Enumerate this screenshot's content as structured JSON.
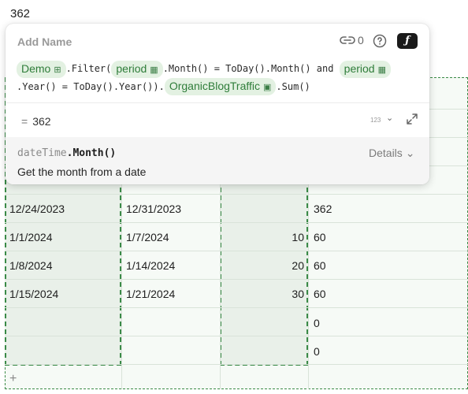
{
  "cell_value": "362",
  "popover": {
    "name_placeholder": "Add Name",
    "links_count": "0",
    "fx_label": "ƒ",
    "formula": {
      "chip_demo": "Demo",
      "t_filter": ".Filter(",
      "chip_period1": "period",
      "t_month_eq": ".Month() = ToDay().Month() and ",
      "chip_period2": "period",
      "t_year_eq": ".Year() = ToDay().Year()).",
      "chip_traffic": "OrganicBlogTraffic",
      "t_sum": ".Sum()"
    },
    "result_eq": "=",
    "result_value": "362",
    "result_type": "123",
    "doc_signature_prefix": "dateTime",
    "doc_signature_fn": ".Month()",
    "doc_details": "Details",
    "doc_description": "Get the month from a date"
  },
  "table": {
    "rows": [
      {
        "start": "12/24/2023",
        "end": "12/31/2023",
        "num": "",
        "total": "362"
      },
      {
        "start": "1/1/2024",
        "end": "1/7/2024",
        "num": "10",
        "total": "60"
      },
      {
        "start": "1/8/2024",
        "end": "1/14/2024",
        "num": "20",
        "total": "60"
      },
      {
        "start": "1/15/2024",
        "end": "1/21/2024",
        "num": "30",
        "total": "60"
      },
      {
        "start": "",
        "end": "",
        "num": "",
        "total": "0"
      },
      {
        "start": "",
        "end": "",
        "num": "",
        "total": "0"
      }
    ],
    "add_row": "+"
  },
  "colors": {
    "accent": "#3a8a47",
    "chip_bg": "#e3f1e2",
    "chip_text": "#2f7d3a"
  }
}
